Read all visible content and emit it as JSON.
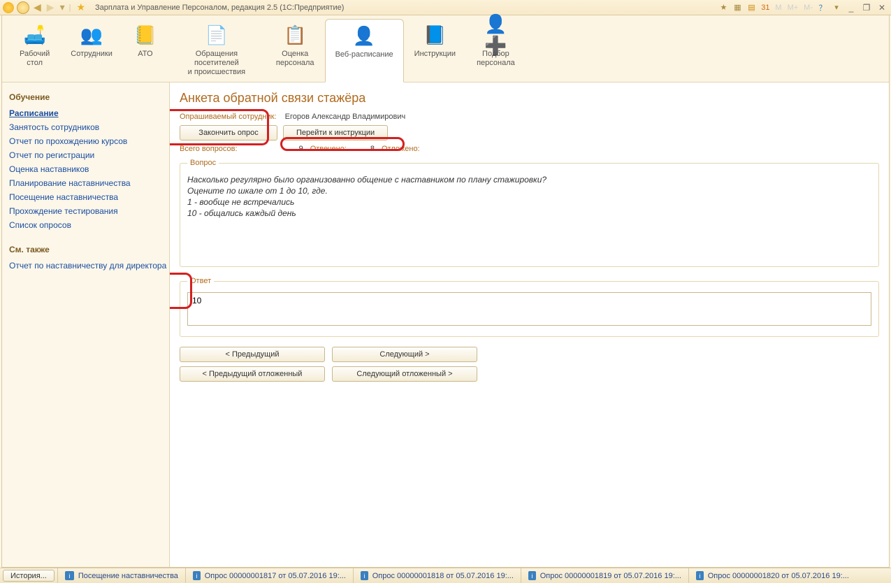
{
  "title": "Зарплата и Управление Персоналом, редакция 2.5  (1С:Предприятие)",
  "sections": [
    {
      "label": "Рабочий\nстол",
      "icon": "🛋️"
    },
    {
      "label": "Сотрудники",
      "icon": "👥"
    },
    {
      "label": "АТО",
      "icon": "📒"
    },
    {
      "label": "Обращения посетителей\nи происшествия",
      "icon": "📄"
    },
    {
      "label": "Оценка\nперсонала",
      "icon": "📋"
    },
    {
      "label": "Веб-расписание",
      "icon": "👤"
    },
    {
      "label": "Инструкции",
      "icon": "📘"
    },
    {
      "label": "Подбор\nперсонала",
      "icon": "👤➕"
    }
  ],
  "active_section_index": 5,
  "sidebar": {
    "group1_title": "Обучение",
    "items1": [
      "Расписание",
      "Занятость сотрудников",
      "Отчет по прохождению курсов",
      "Отчет по регистрации",
      "Оценка наставников",
      "Планирование наставничества",
      "Посещение наставничества",
      "Прохождение тестирования",
      "Список опросов"
    ],
    "active_item1_index": 0,
    "group2_title": "См. также",
    "items2": [
      "Отчет по наставничеству для директора"
    ]
  },
  "main": {
    "title": "Анкета обратной связи стажёра",
    "employee_label": "Опрашиваемый сотрудник:",
    "employee_value": "Егоров Александр Владимирович",
    "btn_finish": "Закончить опрос",
    "btn_goto_instruction": "Перейти к инструкции",
    "stats": {
      "total_label": "Всего вопросов:",
      "total": "9",
      "answered_label": "Отвечено:",
      "answered": "8",
      "deferred_label": "Отложено:"
    },
    "question_legend": "Вопрос",
    "question_body": "Насколько регулярно было организованно общение с наставником по плану стажировки?\nОцените по шкале от 1 до 10, где.\n1 - вообще не встречались\n10 - общались каждый день",
    "answer_legend": "Ответ",
    "answer_value": "10",
    "nav": {
      "prev": "< Предыдущий",
      "next": "Следующий >",
      "prev_def": "< Предыдущий отложенный",
      "next_def": "Следующий отложенный >"
    }
  },
  "statusbar": {
    "history": "История...",
    "tabs": [
      "Посещение наставничества",
      "Опрос 00000001817 от 05.07.2016 19:...",
      "Опрос 00000001818 от 05.07.2016 19:...",
      "Опрос 00000001819 от 05.07.2016 19:...",
      "Опрос 00000001820 от 05.07.2016 19:..."
    ]
  },
  "win": {
    "min": "_",
    "restore": "❐",
    "close": "✕",
    "help": "？"
  }
}
